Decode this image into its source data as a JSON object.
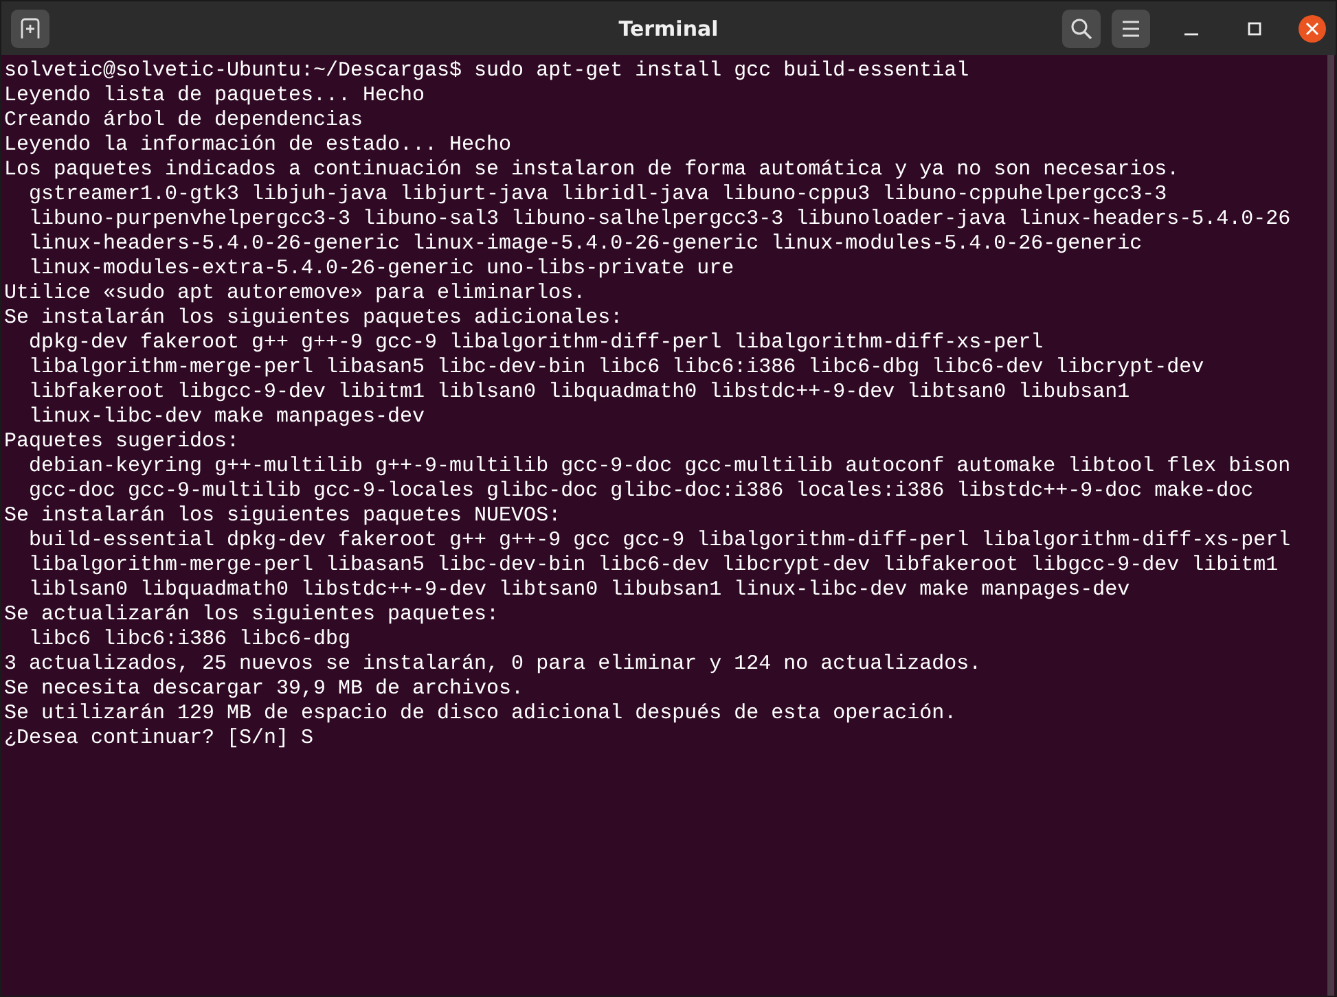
{
  "window": {
    "title": "Terminal"
  },
  "terminal": {
    "lines": [
      "solvetic@solvetic-Ubuntu:~/Descargas$ sudo apt-get install gcc build-essential",
      "Leyendo lista de paquetes... Hecho",
      "Creando árbol de dependencias",
      "Leyendo la información de estado... Hecho",
      "Los paquetes indicados a continuación se instalaron de forma automática y ya no son necesarios.",
      "  gstreamer1.0-gtk3 libjuh-java libjurt-java libridl-java libuno-cppu3 libuno-cppuhelpergcc3-3",
      "  libuno-purpenvhelpergcc3-3 libuno-sal3 libuno-salhelpergcc3-3 libunoloader-java linux-headers-5.4.0-26",
      "  linux-headers-5.4.0-26-generic linux-image-5.4.0-26-generic linux-modules-5.4.0-26-generic",
      "  linux-modules-extra-5.4.0-26-generic uno-libs-private ure",
      "Utilice «sudo apt autoremove» para eliminarlos.",
      "Se instalarán los siguientes paquetes adicionales:",
      "  dpkg-dev fakeroot g++ g++-9 gcc-9 libalgorithm-diff-perl libalgorithm-diff-xs-perl",
      "  libalgorithm-merge-perl libasan5 libc-dev-bin libc6 libc6:i386 libc6-dbg libc6-dev libcrypt-dev",
      "  libfakeroot libgcc-9-dev libitm1 liblsan0 libquadmath0 libstdc++-9-dev libtsan0 libubsan1",
      "  linux-libc-dev make manpages-dev",
      "Paquetes sugeridos:",
      "  debian-keyring g++-multilib g++-9-multilib gcc-9-doc gcc-multilib autoconf automake libtool flex bison",
      "  gcc-doc gcc-9-multilib gcc-9-locales glibc-doc glibc-doc:i386 locales:i386 libstdc++-9-doc make-doc",
      "Se instalarán los siguientes paquetes NUEVOS:",
      "  build-essential dpkg-dev fakeroot g++ g++-9 gcc gcc-9 libalgorithm-diff-perl libalgorithm-diff-xs-perl",
      "  libalgorithm-merge-perl libasan5 libc-dev-bin libc6-dev libcrypt-dev libfakeroot libgcc-9-dev libitm1",
      "  liblsan0 libquadmath0 libstdc++-9-dev libtsan0 libubsan1 linux-libc-dev make manpages-dev",
      "Se actualizarán los siguientes paquetes:",
      "  libc6 libc6:i386 libc6-dbg",
      "3 actualizados, 25 nuevos se instalarán, 0 para eliminar y 124 no actualizados.",
      "Se necesita descargar 39,9 MB de archivos.",
      "Se utilizarán 129 MB de espacio de disco adicional después de esta operación.",
      "¿Desea continuar? [S/n] S"
    ]
  }
}
